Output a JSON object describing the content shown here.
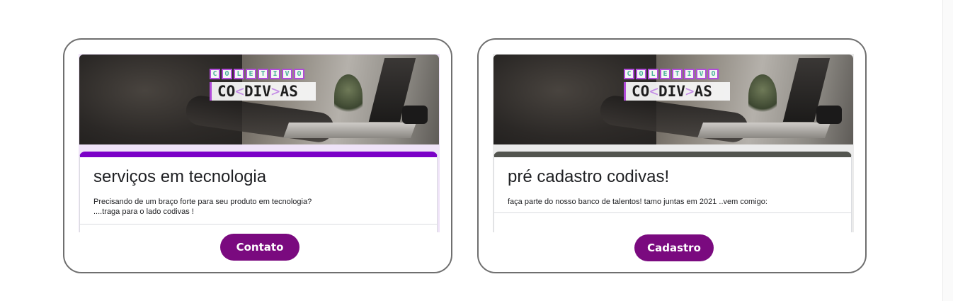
{
  "cards": [
    {
      "logo": {
        "top_letters": [
          "C",
          "O",
          "L",
          "E",
          "T",
          "I",
          "V",
          "O"
        ],
        "bottom_parts": [
          "CO",
          "<",
          "DIV",
          ">",
          "AS"
        ]
      },
      "form_title": "serviços em tecnologia",
      "form_description_line1": "Precisando de um braço forte para seu produto  em tecnologia?",
      "form_description_line2": "....traga para o lado codivas !",
      "button_label": "Contato",
      "accent_color": "#7b00c7"
    },
    {
      "logo": {
        "top_letters": [
          "C",
          "O",
          "L",
          "E",
          "T",
          "I",
          "V",
          "O"
        ],
        "bottom_parts": [
          "CO",
          "<",
          "DIV",
          ">",
          "AS"
        ]
      },
      "form_title": "pré cadastro codivas!",
      "form_description_line1": "faça parte do nosso banco de talentos! tamo juntas em 2021 ..vem comigo:",
      "button_label": "Cadastro",
      "accent_color": "#53554f"
    }
  ],
  "colors": {
    "button_background": "#7a0a7f",
    "card_border": "#6f6f6f",
    "logo_border": "#b14bd9",
    "logo_letter": "#4bb39b"
  }
}
